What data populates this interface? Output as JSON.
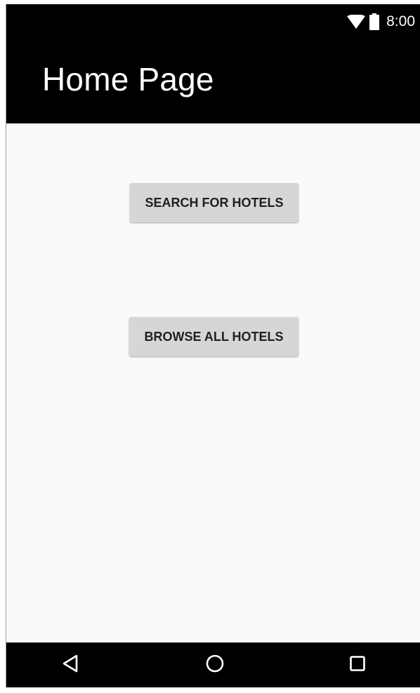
{
  "status_bar": {
    "time": "8:00",
    "icons": [
      "wifi-icon",
      "battery-icon"
    ]
  },
  "app_bar": {
    "title": "Home Page"
  },
  "main": {
    "buttons": [
      {
        "label": "SEARCH FOR HOTELS"
      },
      {
        "label": "BROWSE ALL HOTELS"
      }
    ]
  },
  "nav_bar": {
    "icons": [
      "back-icon",
      "home-icon",
      "recents-icon"
    ]
  },
  "colors": {
    "app_bar": "#000000",
    "background": "#fafafa",
    "button": "#d6d6d6",
    "button_text": "#1f1f1f"
  }
}
